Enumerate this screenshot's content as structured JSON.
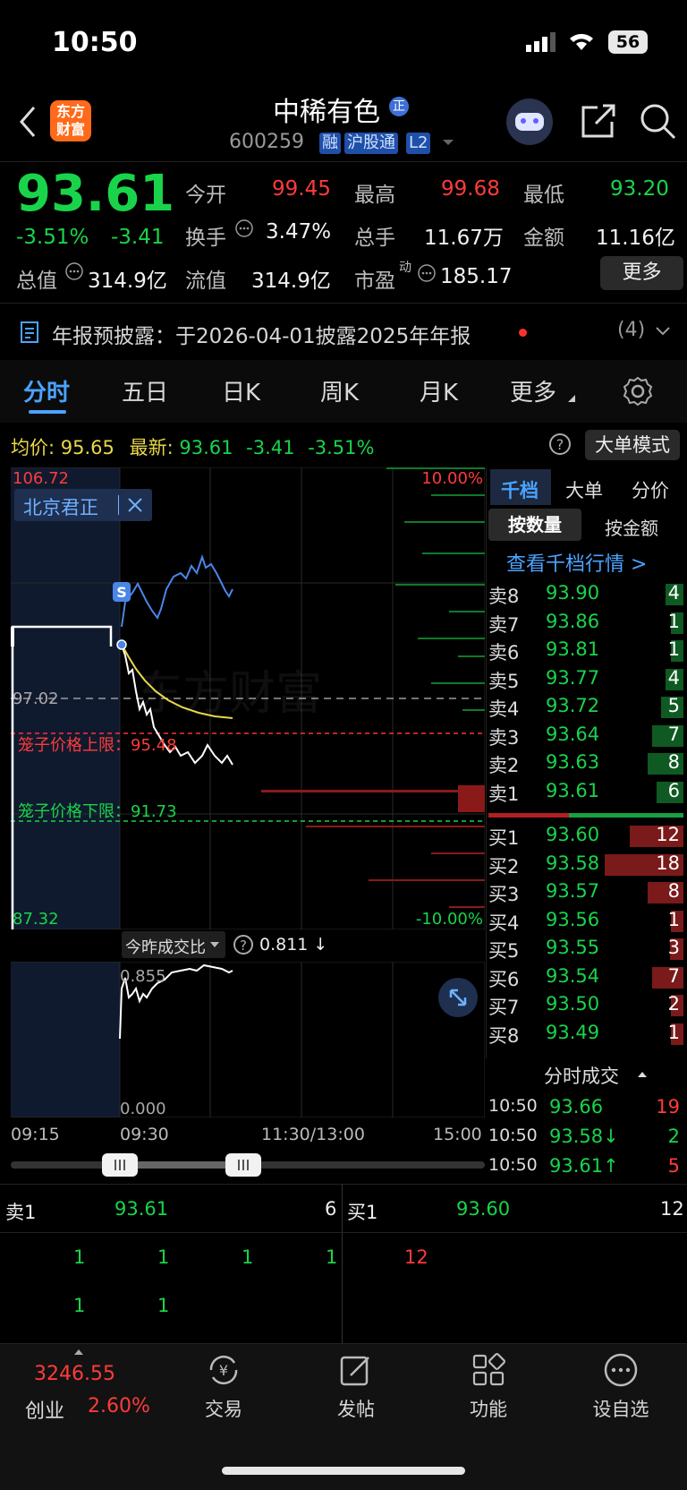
{
  "status": {
    "time": "10:50",
    "battery": "56"
  },
  "header": {
    "logo": "东方财富",
    "stock_name": "中稀有色",
    "name_badge": "正",
    "code": "600259",
    "tags": [
      "融",
      "沪股通",
      "L2"
    ]
  },
  "quote": {
    "price": "93.61",
    "change_pct": "-3.51%",
    "change": "-3.41",
    "fields": {
      "open_label": "今开",
      "open": "99.45",
      "high_label": "最高",
      "high": "99.68",
      "low_label": "最低",
      "low": "93.20",
      "turnover_label": "换手",
      "turnover": "3.47%",
      "volume_label": "总手",
      "volume": "11.67万",
      "amount_label": "金额",
      "amount": "11.16亿",
      "mktcap_label": "总值",
      "mktcap": "314.9亿",
      "float_label": "流值",
      "float": "314.9亿",
      "pe_label": "市盈",
      "pe_sup": "动",
      "pe": "185.17",
      "more": "更多"
    }
  },
  "notice": {
    "text": "年报预披露：于2026-04-01披露2025年年报",
    "count": "(4)"
  },
  "tabs": [
    "分时",
    "五日",
    "日K",
    "周K",
    "月K",
    "更多"
  ],
  "active_tab": "分时",
  "chart_header": {
    "avg_label": "均价:",
    "avg": "95.65",
    "last_label": "最新:",
    "last": "93.61",
    "chg": "-3.41",
    "pct": "-3.51%",
    "mode_button": "大单模式"
  },
  "chart": {
    "top_price": "106.72",
    "bottom_price": "87.32",
    "top_pct": "10.00%",
    "bottom_pct": "-10.00%",
    "mid_price": "97.02",
    "broker_tag": "北京君正",
    "cage_upper": "笼子价格上限：95.48",
    "cage_lower": "笼子价格下限：91.73",
    "s_marker": "S",
    "watermark": "东方财富"
  },
  "volume_panel": {
    "selector": "今昨成交比",
    "value": "0.811 ↓",
    "top_label": "0.855",
    "bottom_label": "0.000",
    "x_labels": [
      "09:15",
      "09:30",
      "11:30/13:00",
      "15:00"
    ]
  },
  "orderbook": {
    "tabs": [
      "千档",
      "大单",
      "分价"
    ],
    "subtabs": [
      "按数量",
      "按金额"
    ],
    "link": "查看千档行情 >",
    "asks": [
      {
        "label": "卖8",
        "price": "93.90",
        "qty": "4"
      },
      {
        "label": "卖7",
        "price": "93.86",
        "qty": "1"
      },
      {
        "label": "卖6",
        "price": "93.81",
        "qty": "1"
      },
      {
        "label": "卖5",
        "price": "93.77",
        "qty": "4"
      },
      {
        "label": "卖4",
        "price": "93.72",
        "qty": "5"
      },
      {
        "label": "卖3",
        "price": "93.64",
        "qty": "7"
      },
      {
        "label": "卖2",
        "price": "93.63",
        "qty": "8"
      },
      {
        "label": "卖1",
        "price": "93.61",
        "qty": "6"
      }
    ],
    "bids": [
      {
        "label": "买1",
        "price": "93.60",
        "qty": "12"
      },
      {
        "label": "买2",
        "price": "93.58",
        "qty": "18"
      },
      {
        "label": "买3",
        "price": "93.57",
        "qty": "8"
      },
      {
        "label": "买4",
        "price": "93.56",
        "qty": "1"
      },
      {
        "label": "买5",
        "price": "93.55",
        "qty": "3"
      },
      {
        "label": "买6",
        "price": "93.54",
        "qty": "7"
      },
      {
        "label": "买7",
        "price": "93.50",
        "qty": "2"
      },
      {
        "label": "买8",
        "price": "93.49",
        "qty": "1"
      }
    ],
    "trades_title": "分时成交",
    "trades": [
      {
        "time": "10:50",
        "price": "93.66",
        "arrow": "",
        "qty": "19"
      },
      {
        "time": "10:50",
        "price": "93.58↓",
        "arrow": "",
        "qty": "2"
      },
      {
        "time": "10:50",
        "price": "93.61↑",
        "arrow": "",
        "qty": "5"
      }
    ]
  },
  "level1": {
    "sell_label": "卖1",
    "sell_price": "93.61",
    "sell_qty": "6",
    "buy_label": "买1",
    "buy_price": "93.60",
    "buy_qty": "12",
    "sell_detail_row1": [
      "1",
      "1",
      "1",
      "1"
    ],
    "sell_detail_row2": [
      "1",
      "1"
    ],
    "buy_detail": [
      "12"
    ]
  },
  "bottom_nav": {
    "index_value": "3246.55",
    "index_name": "创业",
    "index_pct": "2.60%",
    "items": [
      "交易",
      "发帖",
      "功能",
      "设自选"
    ]
  },
  "colors": {
    "up": "#ff3b3b",
    "down": "#19d44a",
    "accent": "#4aa3ff"
  }
}
